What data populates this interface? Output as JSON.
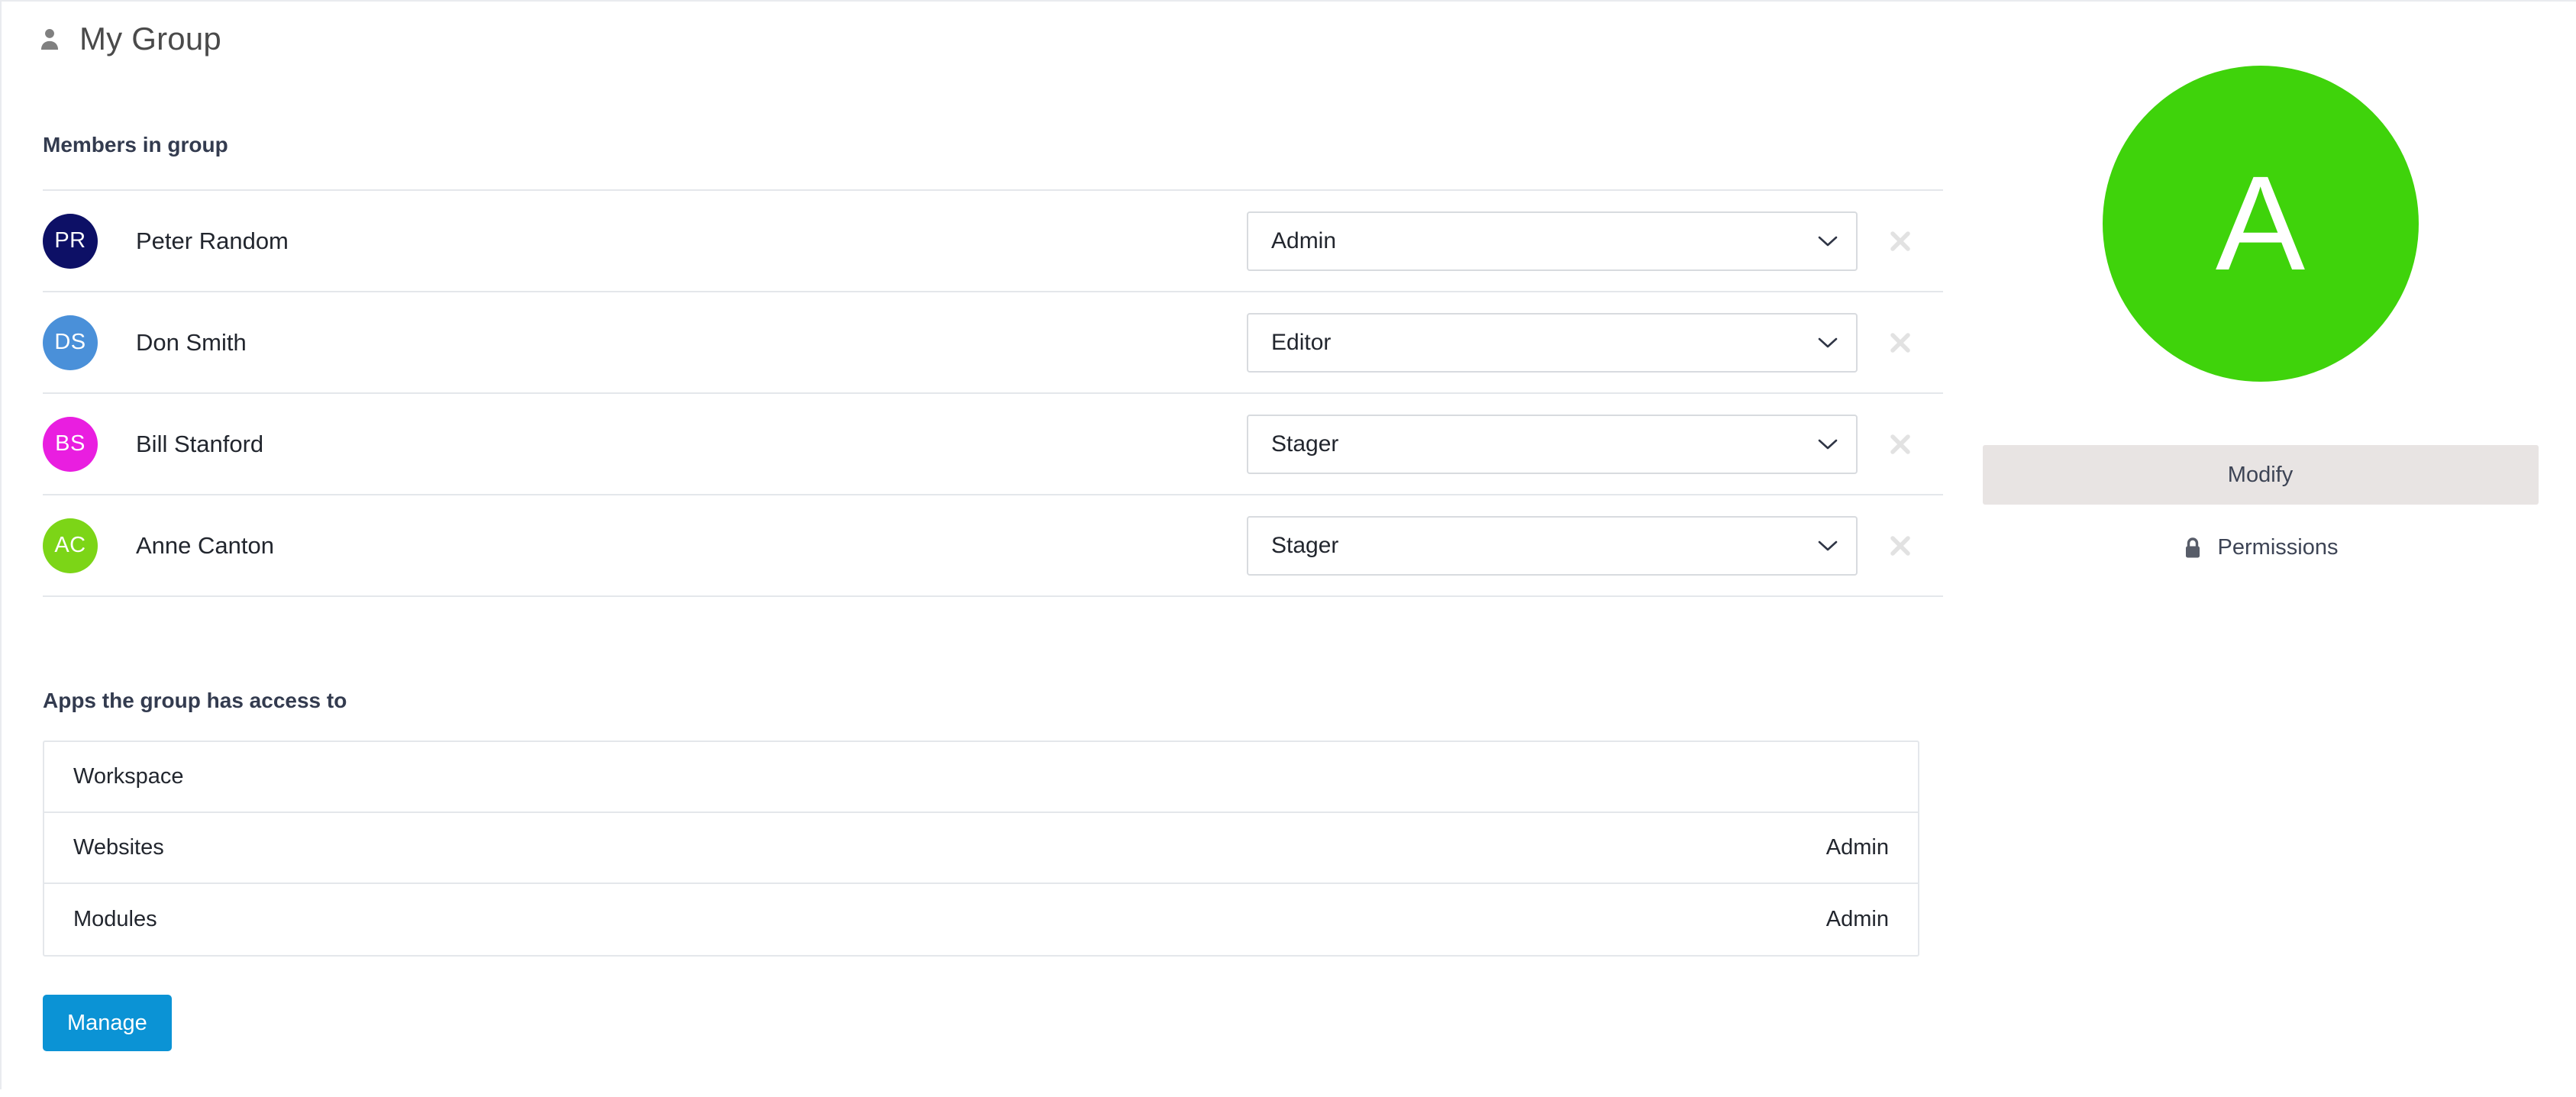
{
  "header": {
    "title": "My Group",
    "icon": "person-icon"
  },
  "members_section": {
    "heading": "Members in group",
    "remove_icon": "close-icon",
    "chevron_icon": "chevron-down-icon",
    "members": [
      {
        "initials": "PR",
        "name": "Peter Random",
        "role": "Admin",
        "color": "#0d1066"
      },
      {
        "initials": "DS",
        "name": "Don Smith",
        "role": "Editor",
        "color": "#4a90d9"
      },
      {
        "initials": "BS",
        "name": "Bill Stanford",
        "role": "Stager",
        "color": "#e91ee0"
      },
      {
        "initials": "AC",
        "name": "Anne Canton",
        "role": "Stager",
        "color": "#7cd517"
      }
    ],
    "role_options": [
      "Admin",
      "Editor",
      "Stager"
    ]
  },
  "apps_section": {
    "heading": "Apps the group has access to",
    "rows": [
      {
        "name": "Workspace",
        "role": ""
      },
      {
        "name": "Websites",
        "role": "Admin"
      },
      {
        "name": "Modules",
        "role": "Admin"
      }
    ],
    "manage_label": "Manage"
  },
  "group_panel": {
    "avatar_letter": "A",
    "avatar_color": "#3fd30b",
    "modify_label": "Modify",
    "permissions_label": "Permissions",
    "lock_icon": "lock-icon"
  },
  "colors": {
    "accent_blue": "#0b93d5",
    "modify_bg": "#e8e4e3",
    "border": "#e4e7eb",
    "heading": "#333b4f"
  }
}
